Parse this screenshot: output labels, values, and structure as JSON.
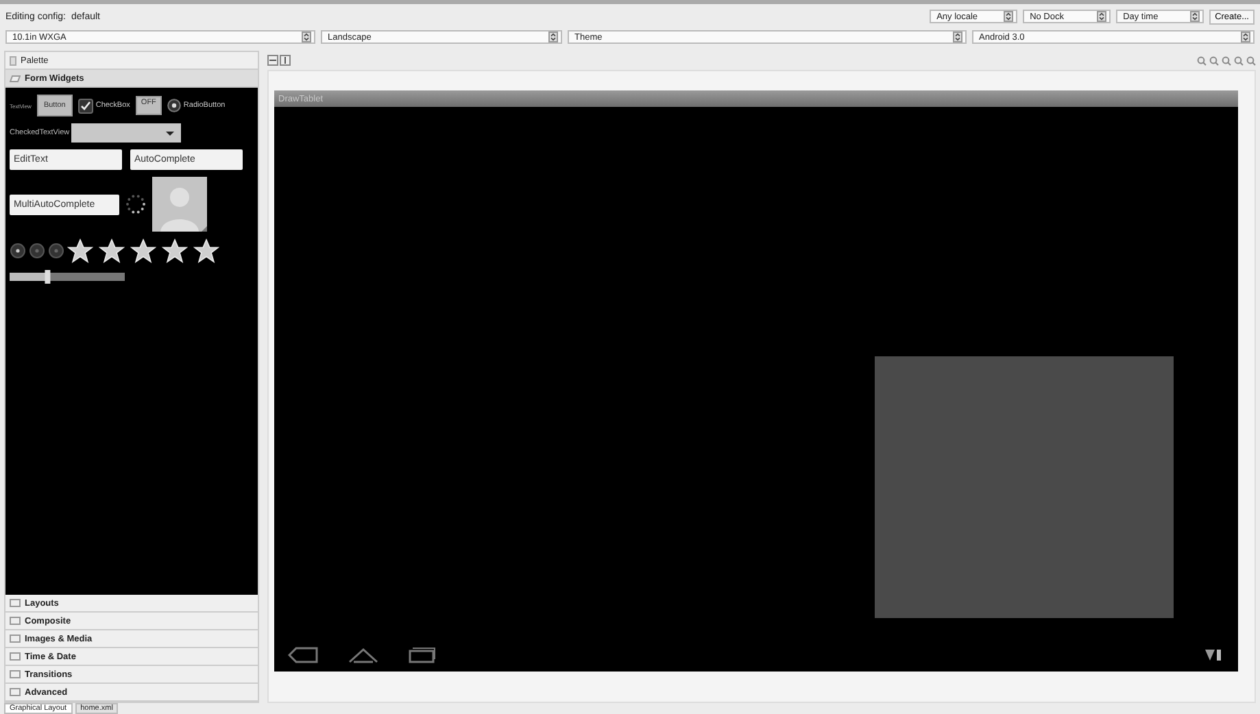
{
  "config": {
    "label": "Editing config:",
    "value": "default"
  },
  "top_selects": [
    {
      "value": "Any locale"
    },
    {
      "value": "No Dock"
    },
    {
      "value": "Day time"
    }
  ],
  "create_button": "Create...",
  "selects": [
    {
      "value": "10.1in WXGA"
    },
    {
      "value": "Landscape"
    },
    {
      "value": "Theme"
    },
    {
      "value": "Android 3.0"
    }
  ],
  "palette": {
    "title": "Palette",
    "open_group": {
      "label": "Form Widgets",
      "expanded": true
    },
    "widgets": {
      "textview": "TextView",
      "button": "Button",
      "checkbox": {
        "label": "CheckBox",
        "checked": true
      },
      "toggle": "OFF",
      "radio": {
        "label": "RadioButton",
        "selected": true
      },
      "checked_text_view": "CheckedTextView",
      "edit_text": "EditText",
      "auto_complete": "AutoComplete",
      "multi_auto_complete": "MultiAutoComplete",
      "rating": {
        "stars": 5
      },
      "seek_bar": {
        "level": 0.33
      }
    },
    "groups": [
      {
        "label": "Layouts",
        "expanded": false
      },
      {
        "label": "Composite",
        "expanded": false
      },
      {
        "label": "Images & Media",
        "expanded": false
      },
      {
        "label": "Time & Date",
        "expanded": false
      },
      {
        "label": "Transitions",
        "expanded": false
      },
      {
        "label": "Advanced",
        "expanded": false
      }
    ]
  },
  "device": {
    "title": "DrawTablet"
  },
  "editor_tabs": [
    {
      "label": "Graphical Layout",
      "selected": true
    },
    {
      "label": "home.xml",
      "selected": false
    }
  ]
}
